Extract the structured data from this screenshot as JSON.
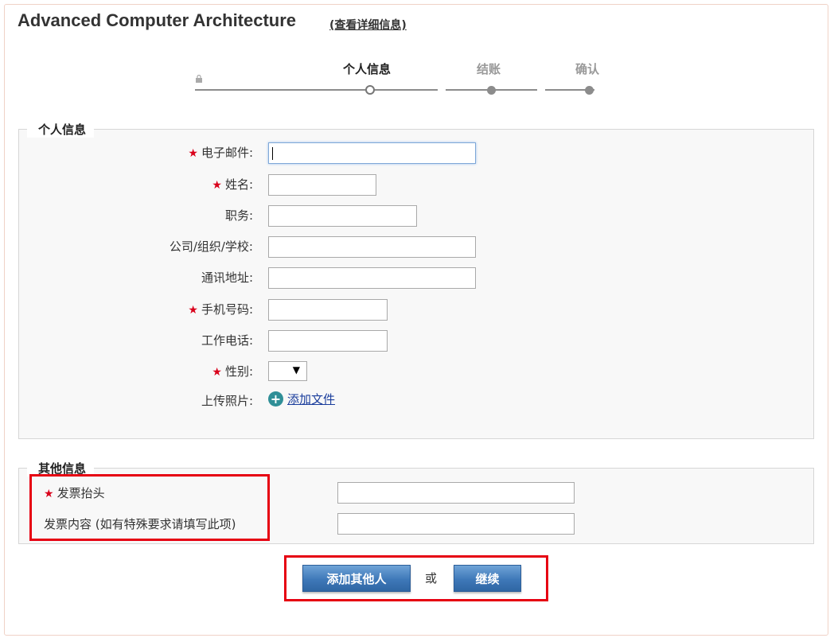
{
  "header": {
    "course_title": "Advanced Computer Architecture",
    "details_link": "(查看详细信息)"
  },
  "steps": [
    {
      "label": "个人信息",
      "state": "active"
    },
    {
      "label": "结账",
      "state": "future"
    },
    {
      "label": "确认",
      "state": "future"
    }
  ],
  "personal": {
    "legend": "个人信息",
    "fields": [
      {
        "label": "电子邮件:",
        "required": true,
        "value": ""
      },
      {
        "label": "姓名:",
        "required": true,
        "value": ""
      },
      {
        "label": "职务:",
        "required": false,
        "value": ""
      },
      {
        "label": "公司/组织/学校:",
        "required": false,
        "value": ""
      },
      {
        "label": "通讯地址:",
        "required": false,
        "value": ""
      },
      {
        "label": "手机号码:",
        "required": true,
        "value": ""
      },
      {
        "label": "工作电话:",
        "required": false,
        "value": ""
      },
      {
        "label": "性别:",
        "required": true,
        "value": ""
      },
      {
        "label": "上传照片:",
        "required": false,
        "value": ""
      }
    ],
    "gender_arrow": "▼",
    "add_file": "添加文件",
    "star": "★"
  },
  "other": {
    "legend": "其他信息",
    "invoice_title_label": "发票抬头",
    "invoice_content_label": "发票内容 (如有特殊要求请填写此项)",
    "invoice_title_value": "",
    "invoice_content_value": ""
  },
  "actions": {
    "add_person": "添加其他人",
    "or": "或",
    "continue": "继续"
  },
  "colors": {
    "accent": "#3e78b8",
    "required_star": "#d9001b",
    "highlight": "#e60012"
  }
}
